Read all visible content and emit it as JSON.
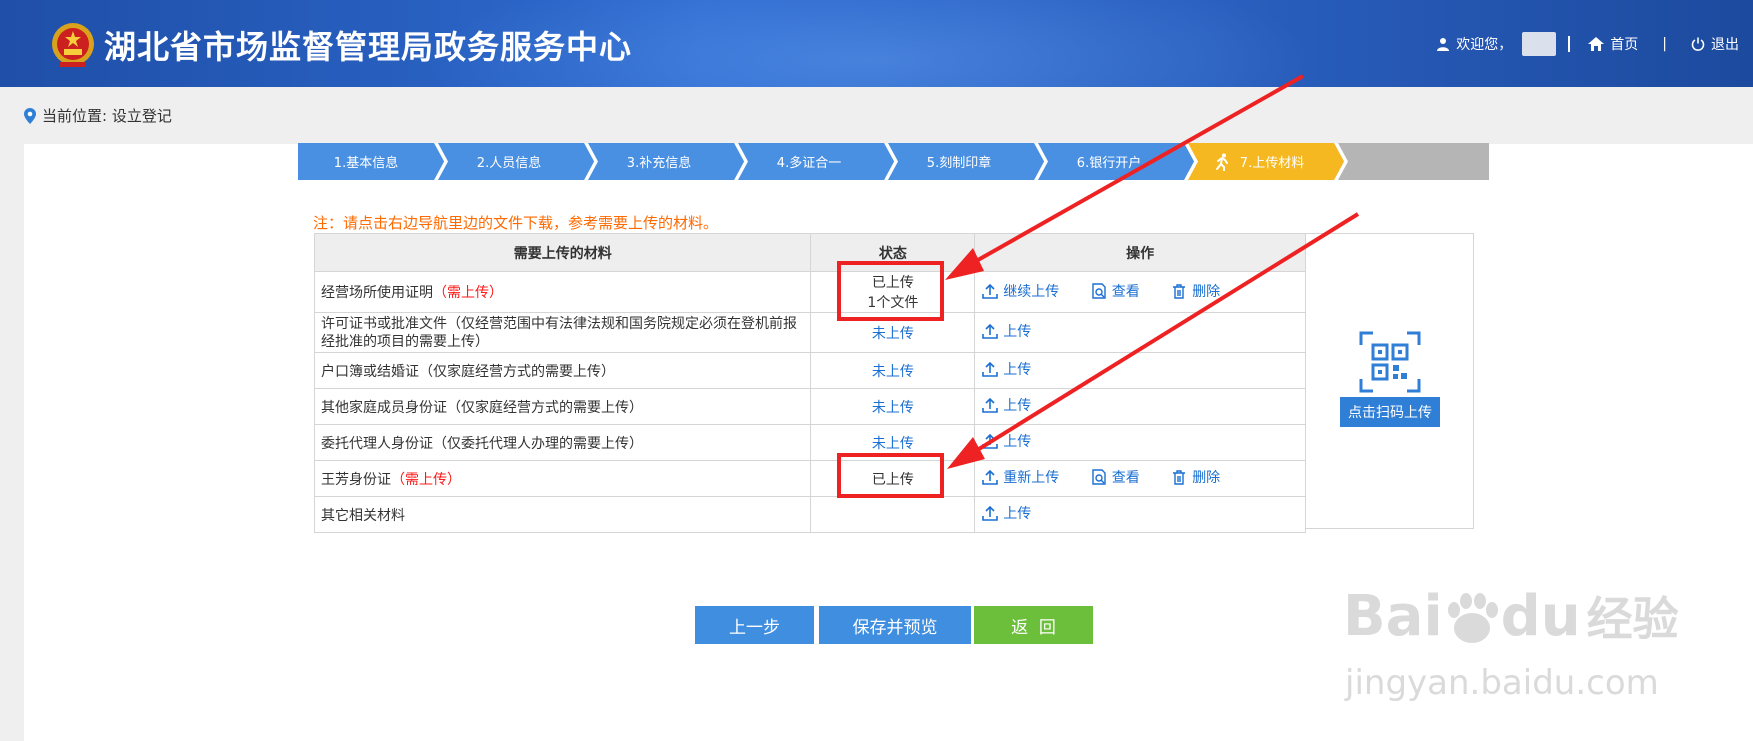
{
  "header": {
    "title": "湖北省市场监督管理局政务服务中心",
    "welcome": "欢迎您，",
    "home": "首页",
    "logout": "退出"
  },
  "breadcrumb": "当前位置: 设立登记",
  "steps": [
    "1.基本信息",
    "2.人员信息",
    "3.补充信息",
    "4.多证合一",
    "5.刻制印章",
    "6.银行开户",
    "7.上传材料"
  ],
  "note": "注：请点击右边导航里边的文件下载，参考需要上传的材料。",
  "table": {
    "headers": [
      "需要上传的材料",
      "状态",
      "操作"
    ],
    "rows": [
      {
        "name": "经营场所使用证明",
        "need": "（需上传）",
        "status1": "已上传",
        "status2": "1个文件",
        "op1": "继续上传",
        "op2": "查看",
        "op3": "删除"
      },
      {
        "name": "许可证书或批准文件（仅经营范围中有法律法规和国务院规定必须在登机前报经批准的项目的需要上传）",
        "need": "",
        "status1": "未上传",
        "status2": "",
        "op1": "上传",
        "op2": "",
        "op3": ""
      },
      {
        "name": "户口簿或结婚证（仅家庭经营方式的需要上传）",
        "need": "",
        "status1": "未上传",
        "status2": "",
        "op1": "上传",
        "op2": "",
        "op3": ""
      },
      {
        "name": "其他家庭成员身份证（仅家庭经营方式的需要上传）",
        "need": "",
        "status1": "未上传",
        "status2": "",
        "op1": "上传",
        "op2": "",
        "op3": ""
      },
      {
        "name": "委托代理人身份证（仅委托代理人办理的需要上传）",
        "need": "",
        "status1": "未上传",
        "status2": "",
        "op1": "上传",
        "op2": "",
        "op3": ""
      },
      {
        "name": "王芳身份证",
        "need": "（需上传）",
        "status1": "已上传",
        "status2": "",
        "op1": "重新上传",
        "op2": "查看",
        "op3": "删除"
      },
      {
        "name": "其它相关材料",
        "need": "",
        "status1": "",
        "status2": "",
        "op1": "上传",
        "op2": "",
        "op3": ""
      }
    ]
  },
  "qr": {
    "button": "点击扫码上传"
  },
  "buttons": {
    "prev": "上一步",
    "save": "保存并预览",
    "back": "返  回"
  },
  "watermark": {
    "brand": "Bai",
    "brand_mid": "du",
    "cn": "经验",
    "url": "jingyan.baidu.com"
  },
  "colors": {
    "header": "#2a5fbf",
    "step": "#4a90e2",
    "step_active": "#f5b820",
    "red": "#ee2222",
    "note": "#ff6a00",
    "link": "#1a6fd1",
    "green": "#6cbf3a"
  }
}
